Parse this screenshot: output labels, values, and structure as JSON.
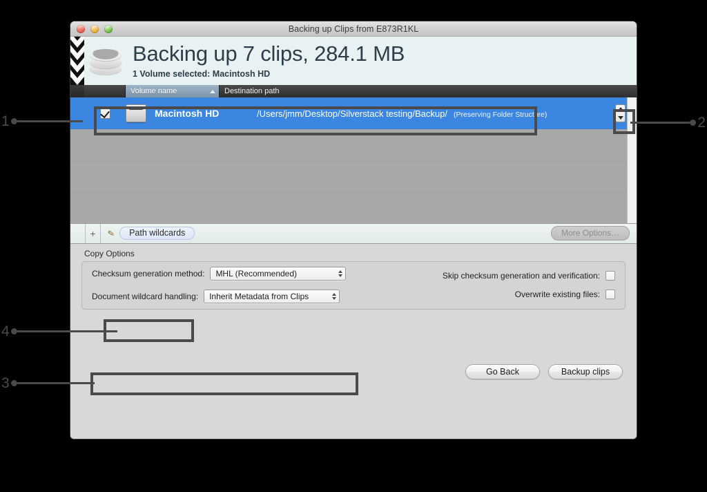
{
  "window": {
    "title": "Backing up Clips from E873R1KL",
    "traffic_lights": [
      "close-button",
      "minimize-button",
      "zoom-button"
    ]
  },
  "header": {
    "icon": "disk-stack-icon",
    "title": "Backing up 7 clips, 284.1 MB",
    "subtitle": "1 Volume selected: Macintosh HD"
  },
  "table": {
    "columns": [
      "Volume name",
      "Destination path"
    ],
    "sort_column": "Volume name",
    "sort_direction": "ascending",
    "rows": [
      {
        "checked": true,
        "icon": "hard-drive-icon",
        "volume_name": "Macintosh HD",
        "destination_path": "/Users/jmm/Desktop/Silverstack testing/Backup/",
        "destination_note": "(Preserving Folder Structure)",
        "stepper": "path-stepper"
      }
    ]
  },
  "wildcard_bar": {
    "add_label": "+",
    "pencil_icon": "pencil-icon",
    "pill_label": "Path wildcards",
    "more_options_label": "More Options…"
  },
  "copy_options": {
    "section_label": "Copy Options",
    "checksum_label": "Checksum generation method:",
    "checksum_value": "MHL (Recommended)",
    "wildcard_label": "Document wildcard handling:",
    "wildcard_value": "Inherit Metadata from Clips",
    "skip_checksum_label": "Skip checksum generation and verification:",
    "skip_checksum_checked": false,
    "overwrite_label": "Overwrite existing files:",
    "overwrite_checked": false
  },
  "footer": {
    "go_back_label": "Go Back",
    "backup_label": "Backup clips"
  },
  "annotations": {
    "markers": [
      {
        "number": "1",
        "target": "row-checkbox"
      },
      {
        "number": "2",
        "target": "path-stepper"
      },
      {
        "number": "3",
        "target": "document-wildcard-handling"
      },
      {
        "number": "4",
        "target": "path-wildcards-pill"
      }
    ]
  },
  "colors": {
    "selection_blue": "#3b86e0",
    "header_banner": "#e9f2f2",
    "annotation_gray": "#4a4a4a",
    "window_chrome": "#d8d8d8"
  }
}
